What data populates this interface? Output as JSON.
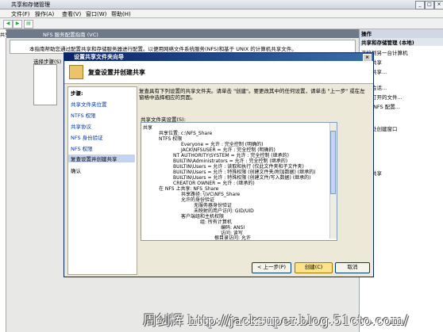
{
  "window": {
    "title": "共享和存储管理"
  },
  "menu": [
    "文件(F)",
    "操作(A)",
    "查看(V)",
    "窗口(W)",
    "帮助(H)"
  ],
  "tree": {
    "root": "共享和存"
  },
  "fsrm_header": "NFS 服务配置指南 (VC)",
  "description": "本指南帮助您通过配置共享和存储服务器进行配置。以便用网络文件系统服务(NFS)和基于 UNIX 的计算机共享文件。",
  "select_steps_label": "选择步骤(S)",
  "right_pane": {
    "header": "操作",
    "sub": "共享和存储管理 (本地)",
    "items": [
      "连接到另一台计算机",
      "设置共享",
      "设置共享...",
      "管理会话...",
      "管理打开的文件...",
      "编辑 NFS 配置...",
      "查看",
      "从此处创建窗口",
      "刷新",
      "帮助",
      "停止共享",
      "属性",
      "帮助"
    ]
  },
  "wizard": {
    "title": "设置共享文件夹向导",
    "heading": "复查设置并创建共享",
    "steps_header": "步骤:",
    "steps": [
      "共享文件夹位置",
      "NTFS 权限",
      "共享协议",
      "NFS 身份验证",
      "NFS 权限",
      "复查设置并创建共享",
      "确认"
    ],
    "intro": "复查具有下列设置的共享文件夹。请单击 \"创建\"。要更改其中的任何设置，请单击 \"上一步\" 或在左窗格中选择相应的页面。",
    "settings_label": "共享文件夹设置(S):",
    "settings_lines": [
      "共享",
      "共享位置: c:\\NFS_Share",
      "NTFS 权限",
      "Everyone = 允许 : 完全控制 (明确的)",
      "JACK\\NFSUSER = 允许 : 完全控制 (明确的)",
      "NT AUTHORITY\\SYSTEM = 允许 : 完全控制 (继承的)",
      "BUILTIN\\Administrators = 允许 : 完全控制 (继承的)",
      "BUILTIN\\Users = 允许 : 读取和执行 (仅此文件夹和子文件夹)",
      "BUILTIN\\Users = 允许 : 特殊权限 (创建文件夹/附加数据) (继承的)",
      "BUILTIN\\Users = 允许 : 特殊权限 (创建文件/写入数据) (继承的)",
      "CREATOR OWNER = 允许 : (继承的)",
      "在 NFS 上共享: NFS_Share",
      "共享路径: \\\\VC\\NFS_Share",
      "允许的身份验证",
      "无服务器身份验证",
      "未映射的用户访问: GID/UID",
      "客户端组和主机权限",
      "组: 所有计算机",
      "编码: ANSI",
      "访问: 读写",
      "根目录访问: 允许"
    ],
    "buttons": {
      "back": "< 上一步(P)",
      "create": "创建(C)",
      "cancel": "取消"
    }
  },
  "watermark": "周剑辉 http://jacksuper.blog.51cto.com/"
}
